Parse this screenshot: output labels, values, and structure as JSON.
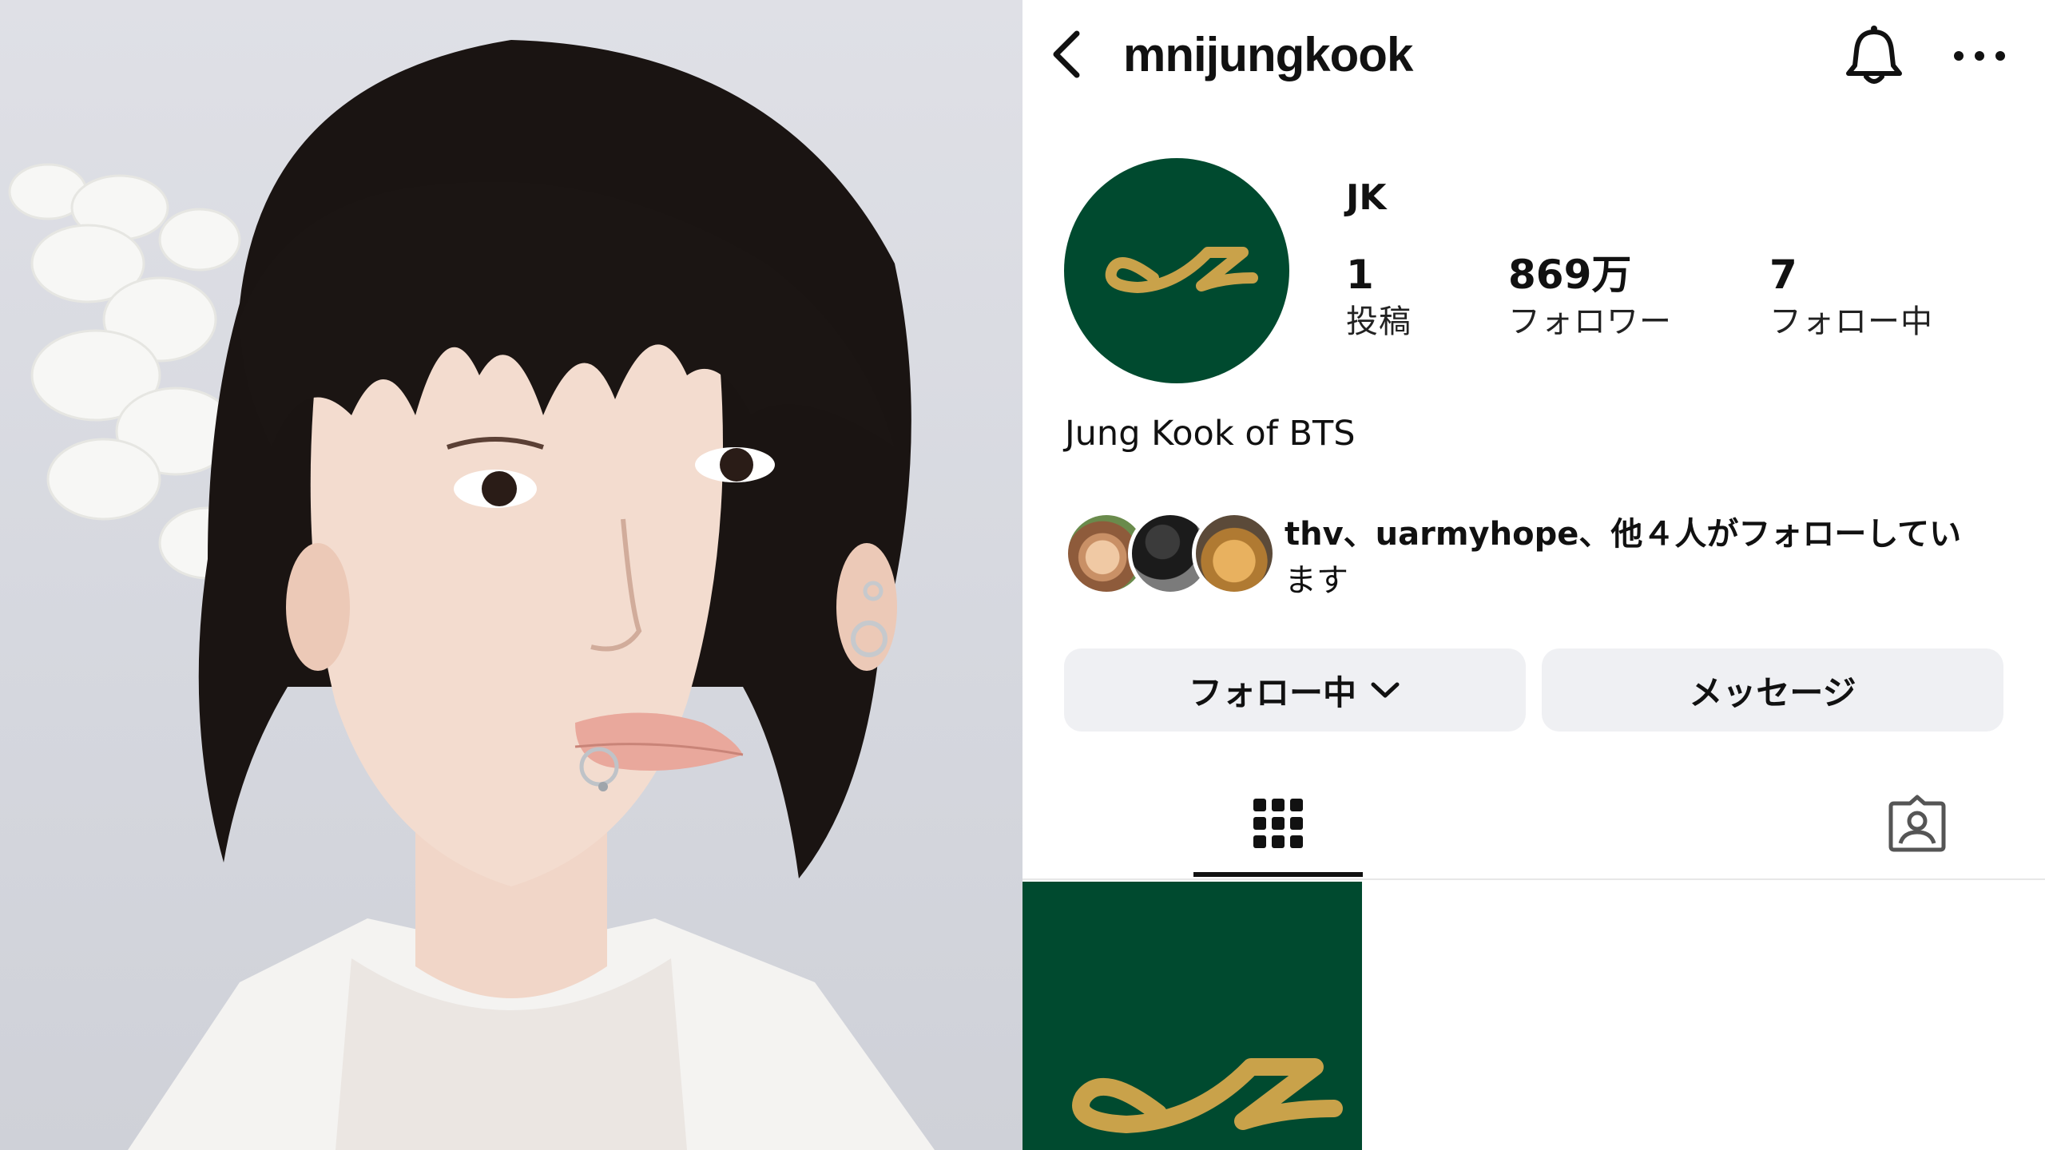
{
  "header": {
    "username": "mnijungkook"
  },
  "profile": {
    "display_name": "JK",
    "avatar_bg_color": "#004a2f",
    "logo_color": "#c9a24a",
    "stats": {
      "posts_count": "1",
      "posts_label": "投稿",
      "followers_count": "869万",
      "followers_label": "フォロワー",
      "following_count": "7",
      "following_label": "フォロー中"
    },
    "bio": "Jung Kook of BTS",
    "mutuals": {
      "names": "thv、uarmyhope、",
      "rest_line1": "他４人がフォローしてい",
      "rest_line2": "ます"
    }
  },
  "buttons": {
    "follow_label": "フォロー中",
    "message_label": "メッセージ"
  },
  "tabs": {
    "active": "grid",
    "items": [
      "grid-icon",
      "tagged-icon"
    ]
  },
  "icons": {
    "back": "chevron-left-icon",
    "bell": "bell-icon",
    "more": "more-horizontal-icon"
  }
}
